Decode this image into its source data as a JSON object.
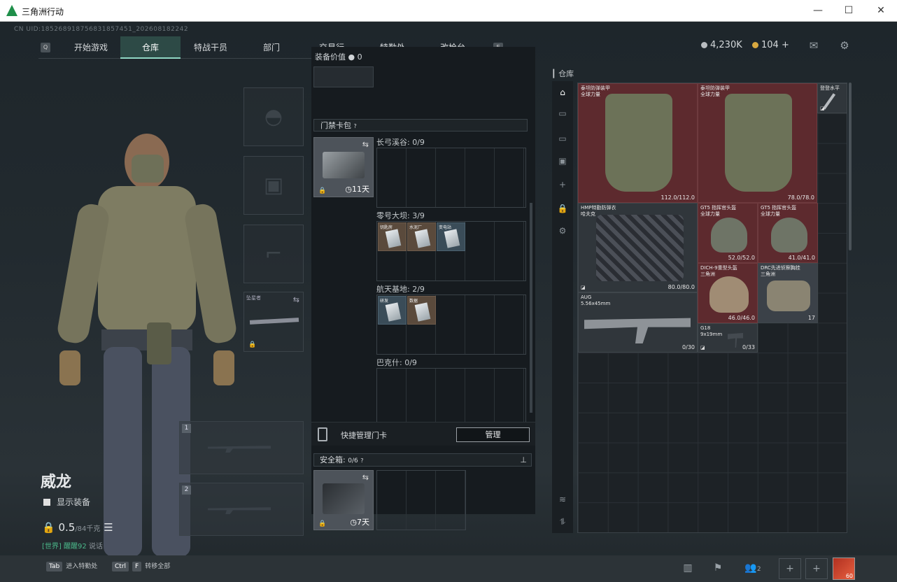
{
  "window": {
    "title": "三角洲行动",
    "minimize": "—",
    "maximize": "☐",
    "close": "✕"
  },
  "uid": "CN UID:185268918756831857451_202608182242",
  "nav": {
    "left_key": "Q",
    "right_key": "E",
    "tabs": [
      "开始游戏",
      "仓库",
      "特战干员",
      "部门",
      "交易行",
      "特勤处",
      "改枪台"
    ],
    "active_tab": "仓库"
  },
  "currency": {
    "coins": "4,230K",
    "tokens": "104",
    "add": "+"
  },
  "equipment": {
    "secure_tag": "坠星者"
  },
  "player": {
    "name": "威龙",
    "show_equipment": "显示装备",
    "weight_value": "0.5",
    "weight_max": "/84千克"
  },
  "chat": {
    "channel": "[世界]",
    "user": "醒醒92",
    "text": "说话"
  },
  "gun_slots": [
    "1",
    "2"
  ],
  "middle": {
    "equip_value_label": "装备价值",
    "equip_value": "0",
    "keycard_header": "门禁卡包",
    "keycard_pack_time": "11天",
    "zones": [
      {
        "name": "长弓溪谷: 0/9",
        "cards": []
      },
      {
        "name": "零号大坝: 3/9",
        "cards": [
          "钥匙房",
          "水泥厂",
          "变电站"
        ]
      },
      {
        "name": "航天基地: 2/9",
        "cards": [
          "研发",
          "数据"
        ]
      },
      {
        "name": "巴克什: 0/9",
        "cards": []
      }
    ],
    "quick_manage": "快捷管理门卡",
    "manage_btn": "管理",
    "safe_label": "安全箱:",
    "safe_count": "0/6",
    "safe_time": "7天"
  },
  "warehouse": {
    "header": "仓库",
    "items": [
      {
        "name": "泰坦防弹装甲",
        "sub": "全球力量",
        "dur": "112.0/112.0"
      },
      {
        "name": "泰坦防弹装甲",
        "sub": "全球力量",
        "dur": "78.0/78.0"
      },
      {
        "name": "登登水平",
        "sub": "",
        "dur": ""
      },
      {
        "name": "HMP特勤防弹衣",
        "sub": "哈夫克",
        "dur": "80.0/80.0"
      },
      {
        "name": "GT5 指挥官头盔",
        "sub": "全球力量",
        "dur": "52.0/52.0"
      },
      {
        "name": "GT5 指挥官头盔",
        "sub": "全球力量",
        "dur": "41.0/41.0"
      },
      {
        "name": "DICH-9重型头盔",
        "sub": "三角洲",
        "dur": "46.0/46.0"
      },
      {
        "name": "DRC先进侦察胸挂",
        "sub": "三角洲",
        "dur": "17"
      },
      {
        "name": "AUG",
        "sub": "5.56x45mm",
        "dur": "0/30"
      },
      {
        "name": "G18",
        "sub": "9x19mm",
        "dur": "0/33"
      }
    ]
  },
  "bottom": {
    "key1": "Tab",
    "label1": "进入特勤处",
    "key2": "Ctrl",
    "key2b": "F",
    "label2": "转移全部",
    "friends": "2",
    "level": "60"
  },
  "icons": [
    "gear-icon",
    "mail-icon",
    "lock-icon",
    "clock-icon",
    "swap-icon",
    "pin-icon",
    "layers-icon",
    "plus-icon"
  ]
}
